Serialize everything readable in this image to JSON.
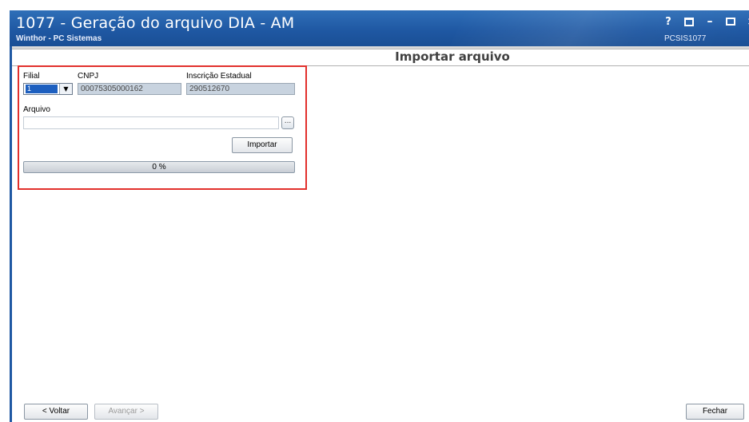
{
  "window": {
    "title": "1077 - Geração do arquivo DIA - AM",
    "subtitle": "Winthor - PC Sistemas",
    "routine_code": "PCSIS1077",
    "controls": {
      "help": "?",
      "restore": "restore",
      "minimize": "–",
      "maximize": "maximize",
      "close": "×"
    }
  },
  "page": {
    "header": "Importar arquivo"
  },
  "form": {
    "filial_label": "Filial",
    "filial_value": "1",
    "cnpj_label": "CNPJ",
    "cnpj_value": "00075305000162",
    "ie_label": "Inscrição Estadual",
    "ie_value": "290512670",
    "arquivo_label": "Arquivo",
    "arquivo_value": "",
    "browse_label": "...",
    "import_button": "Importar",
    "progress_value": 0,
    "progress_text": "0 %"
  },
  "footer": {
    "back_button": "< Voltar",
    "next_button": "Avançar >",
    "close_button": "Fechar"
  },
  "colors": {
    "titlebar": "#1f58a3",
    "highlight": "#e2302c",
    "readonly_field": "#c8d3df"
  }
}
